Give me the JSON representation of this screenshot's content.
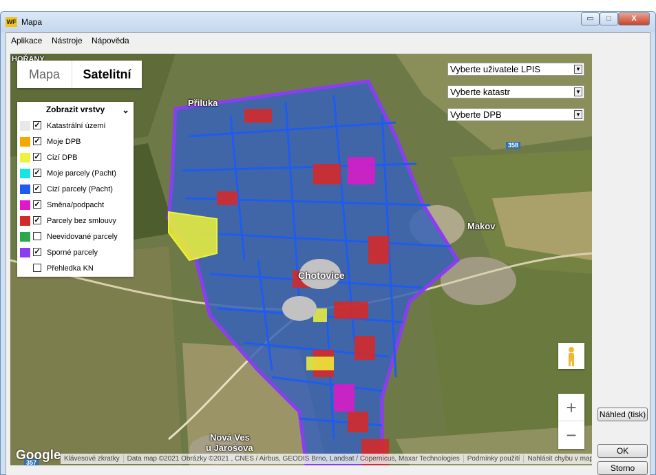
{
  "window": {
    "title": "Mapa",
    "logo_text": "WF",
    "minimize": "▭",
    "maximize": "□",
    "close": "X"
  },
  "menu": {
    "items": [
      {
        "label": "Aplikace"
      },
      {
        "label": "Nástroje"
      },
      {
        "label": "Nápověda"
      }
    ]
  },
  "map": {
    "maptype": {
      "map_label": "Mapa",
      "satellite_label": "Satelitní",
      "active": "Satelitní"
    },
    "layers": {
      "title": "Zobrazit vrstvy",
      "items": [
        {
          "label": "Katastrální území",
          "color": "#e8e8e8",
          "checked": true
        },
        {
          "label": "Moje DPB",
          "color": "#f5a800",
          "checked": true
        },
        {
          "label": "Cizí DPB",
          "color": "#eef23a",
          "checked": true
        },
        {
          "label": "Moje parcely (Pacht)",
          "color": "#18e4e4",
          "checked": true
        },
        {
          "label": "Cizí parcely (Pacht)",
          "color": "#1e5cf0",
          "checked": true
        },
        {
          "label": "Směna/podpacht",
          "color": "#e018c8",
          "checked": true
        },
        {
          "label": "Parcely bez smlouvy",
          "color": "#d42a2a",
          "checked": true
        },
        {
          "label": "Neevidované parcely",
          "color": "#2aa84a",
          "checked": false
        },
        {
          "label": "Sporné parcely",
          "color": "#8a3ef0",
          "checked": true
        },
        {
          "label": "Přehledka KN",
          "color": "",
          "checked": false
        }
      ]
    },
    "selects": {
      "lpis_user": "Vyberte uživatele LPIS",
      "katastr": "Vyberte katastr",
      "dpb": "Vyberte DPB"
    },
    "places": {
      "priluka": "Přiluka",
      "makov": "Makov",
      "chotovice": "Chotovice",
      "nova_ves_1": "Nová Ves",
      "nova_ves_2": "u Jarošova",
      "topleft": "HOŘANY"
    },
    "roads": {
      "r358": "358",
      "r357": "357"
    },
    "logo": "Google",
    "attribution": [
      "Klávesové zkratky",
      "Data map ©2021 Obrázky ©2021 , CNES / Airbus, GEODIS Brno, Landsat / Copernicus, Maxar Technologies",
      "Podmínky použití",
      "Nahlásit chybu v mapě"
    ],
    "zoom_in": "+",
    "zoom_out": "−"
  },
  "side_buttons": {
    "preview": "Náhled (tisk)",
    "ok": "OK",
    "cancel": "Storno"
  }
}
